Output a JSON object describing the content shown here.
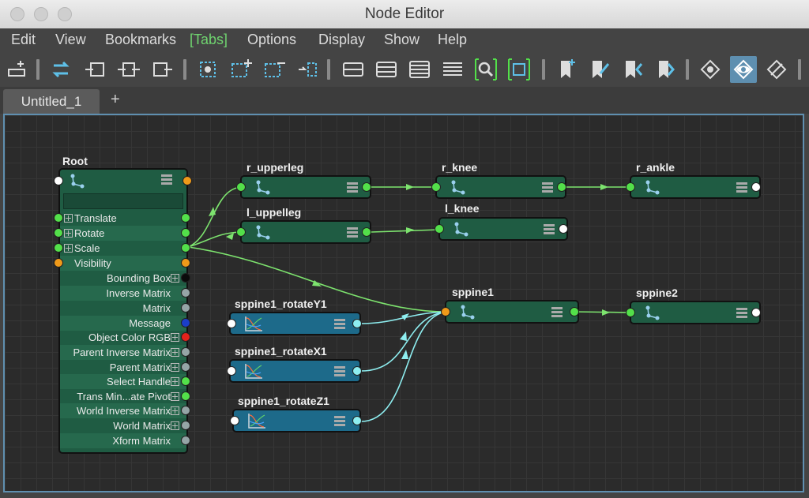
{
  "window": {
    "title": "Node Editor"
  },
  "menu": {
    "edit": "Edit",
    "view": "View",
    "bookmarks": "Bookmarks",
    "tabs": "[Tabs]",
    "options": "Options",
    "display": "Display",
    "show": "Show",
    "help": "Help"
  },
  "tabs": {
    "active": "Untitled_1",
    "add": "+"
  },
  "colors": {
    "node_green": "#1f5c43",
    "node_blue": "#1d6a8a",
    "connection_green": "#7de36e",
    "connection_cyan": "#8eeef0",
    "highlight_blue": "#5f8fb0"
  },
  "nodes": {
    "root": "Root",
    "r_upperleg": "r_upperleg",
    "r_knee": "r_knee",
    "r_ankle": "r_ankle",
    "l_uppelleg": "l_uppelleg",
    "l_knee": "l_knee",
    "sppine1": "sppine1",
    "sppine2": "sppine2",
    "rotY": "sppine1_rotateY1",
    "rotX": "sppine1_rotateX1",
    "rotZ": "sppine1_rotateZ1"
  },
  "root_attributes": [
    {
      "label": "Translate"
    },
    {
      "label": "Rotate"
    },
    {
      "label": "Scale"
    },
    {
      "label": "Visibility"
    },
    {
      "label": "Bounding Box"
    },
    {
      "label": "Inverse Matrix"
    },
    {
      "label": "Matrix"
    },
    {
      "label": "Message"
    },
    {
      "label": "Object Color RGB"
    },
    {
      "label": "Parent Inverse Matrix"
    },
    {
      "label": "Parent Matrix"
    },
    {
      "label": "Select Handle"
    },
    {
      "label": "Trans Min...ate Pivot"
    },
    {
      "label": "World Inverse Matrix"
    },
    {
      "label": "World Matrix"
    },
    {
      "label": "Xform Matrix"
    }
  ]
}
